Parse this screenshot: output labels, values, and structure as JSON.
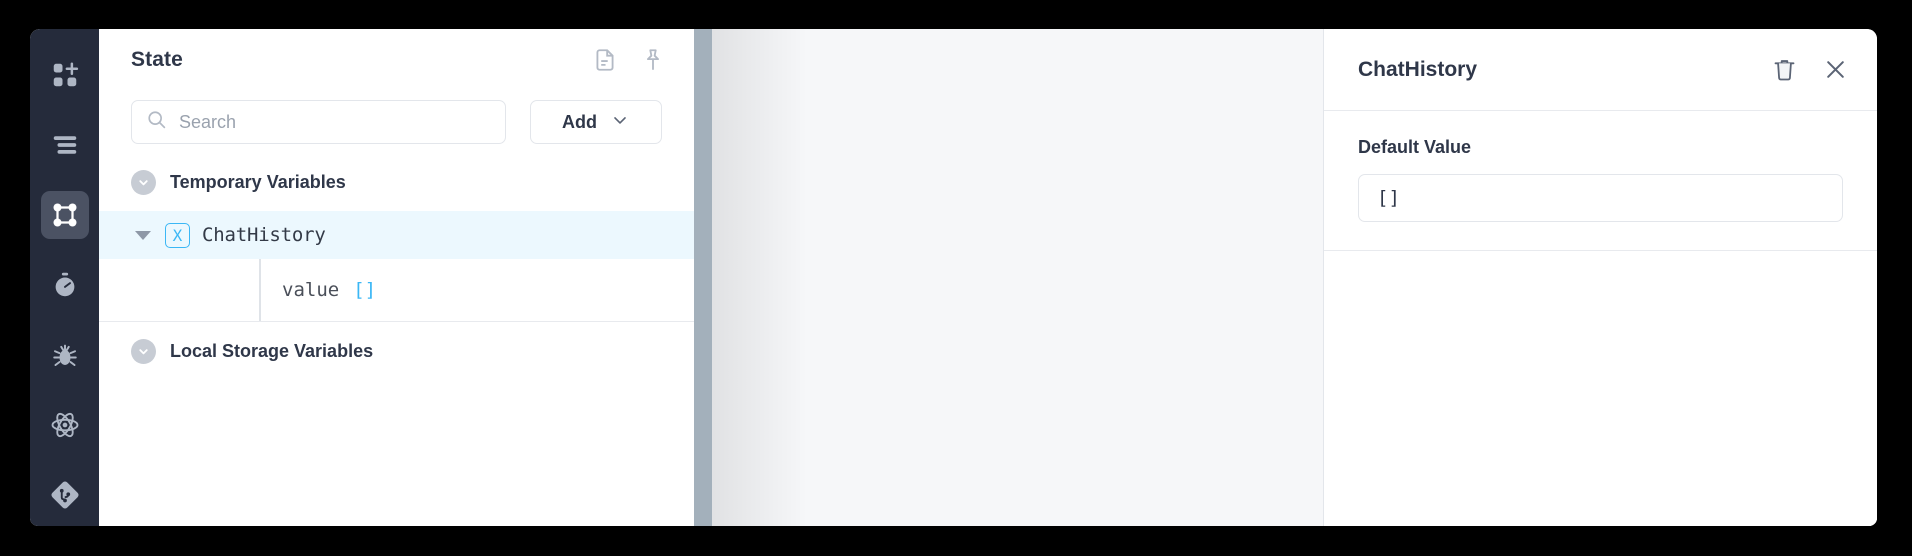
{
  "rail": {
    "items": [
      {
        "name": "add-component-icon",
        "label": "Add Component"
      },
      {
        "name": "list-icon",
        "label": "Pages"
      },
      {
        "name": "state-graph-icon",
        "label": "State"
      },
      {
        "name": "stopwatch-icon",
        "label": "Timers"
      },
      {
        "name": "bug-icon",
        "label": "Debug"
      },
      {
        "name": "atom-icon",
        "label": "Libraries"
      },
      {
        "name": "git-icon",
        "label": "Source Control"
      }
    ],
    "active_index": 2
  },
  "state_panel": {
    "title": "State",
    "header_icons": [
      {
        "name": "document-icon",
        "label": "Open in document view"
      },
      {
        "name": "pin-icon",
        "label": "Pin panel"
      }
    ],
    "search": {
      "placeholder": "Search",
      "value": ""
    },
    "add_button": {
      "label": "Add"
    },
    "groups": [
      {
        "label": "Temporary Variables",
        "expanded": true,
        "variables": [
          {
            "name": "ChatHistory",
            "type_badge": "X",
            "expanded": true,
            "selected": true,
            "properties": [
              {
                "key": "value",
                "value": "[]"
              }
            ]
          }
        ]
      },
      {
        "label": "Local Storage Variables",
        "expanded": true,
        "variables": []
      }
    ]
  },
  "inspector": {
    "title": "ChatHistory",
    "actions": [
      {
        "name": "trash-icon",
        "label": "Delete"
      },
      {
        "name": "close-icon",
        "label": "Close"
      }
    ],
    "fields": [
      {
        "label": "Default Value",
        "value": "[]"
      }
    ]
  },
  "colors": {
    "rail_bg": "#252b3b",
    "accent_blue": "#3bb7f5",
    "selected_row": "#ecf8fe",
    "canvas_bg": "#f6f7f9",
    "text_primary": "#2f3749"
  }
}
